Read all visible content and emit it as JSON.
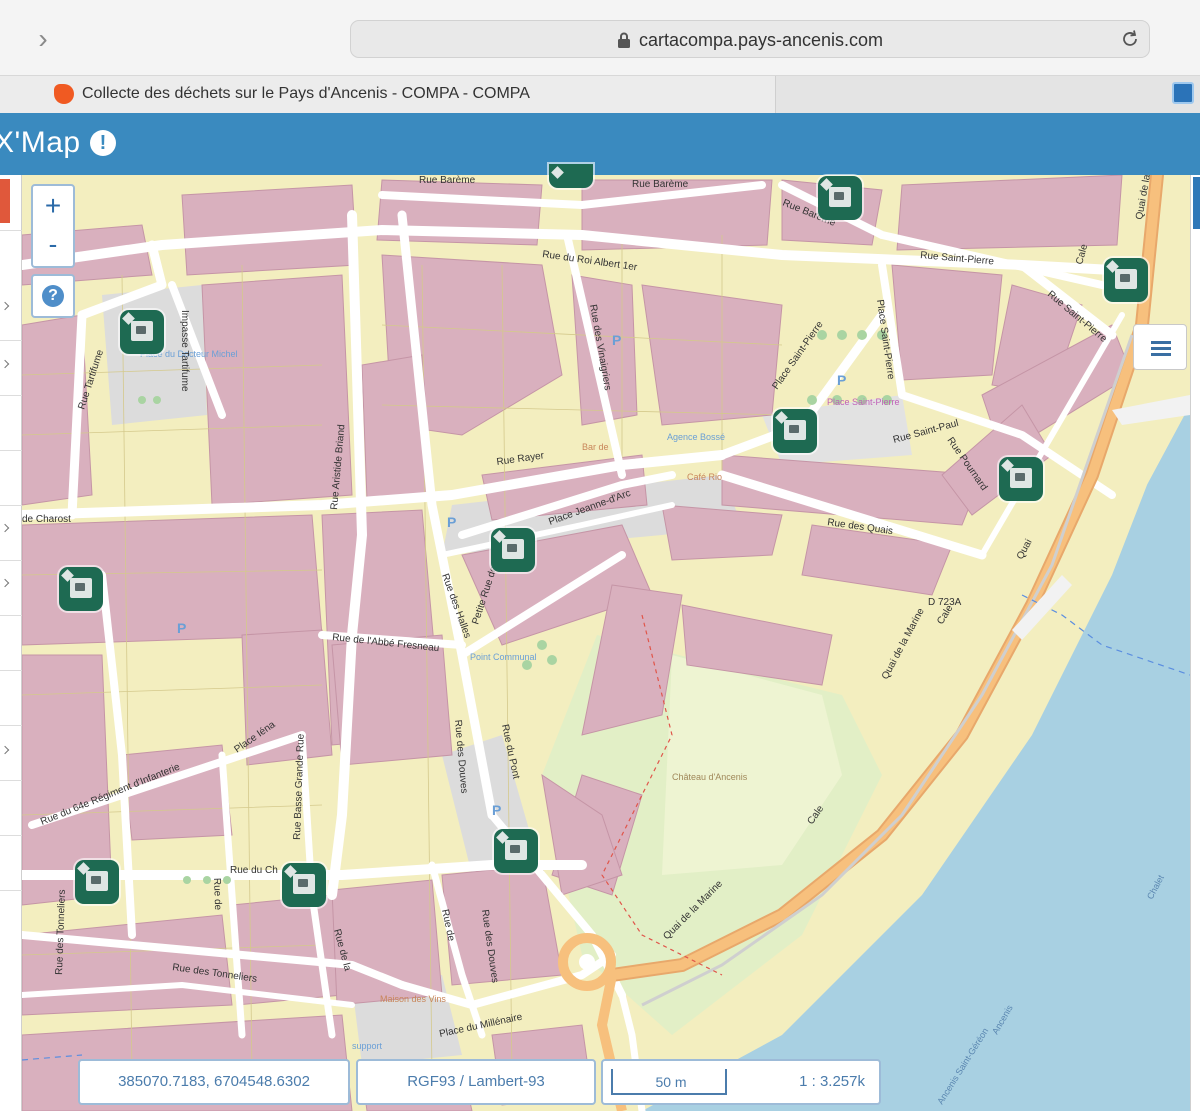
{
  "browser": {
    "url": "cartacompa.pays-ancenis.com",
    "tab_title": "Collecte des déchets sur le Pays d'Ancenis - COMPA - COMPA"
  },
  "app": {
    "title": "X'Map"
  },
  "map": {
    "zoom_in_label": "+",
    "zoom_out_label": "-",
    "help_label": "?",
    "street_labels": [
      "Rue Barème",
      "Rue Barème",
      "Rue Barème",
      "Rue du Roi Albert 1er",
      "Rue Saint-Pierre",
      "Rue Saint-Pierre",
      "Place du Docteur Michel",
      "Impasse Tartifume",
      "Rue Tartifume",
      "Rue des Vinaigriers",
      "Place Saint-Pierre",
      "Place Saint-Pierre",
      "Place Saint-Pierre",
      "Rue Saint-Paul",
      "Rue Pournard",
      "Rue Rayer",
      "Bar de",
      "Agence Bossé",
      "Café Rio",
      "Rue des Quais",
      "Place Jeanne-d'Arc",
      "de Charost",
      "Rue Aristide Briand",
      "Petite Rue des",
      "Rue des Halles",
      "Rue de l'Abbé Fresneau",
      "Point Communal",
      "Rue des Douves",
      "Rue du Pont",
      "D 723A",
      "Quai de la Marine",
      "Cale",
      "Quai",
      "Cale",
      "Quai de la Marine",
      "Château d'Ancenis",
      "Rue Basse Grande Rue",
      "Place Iéna",
      "Rue du 64e Régiment d'Infanterie",
      "Rue du Ch",
      "Rue de",
      "Rue des Tonneliers",
      "Rue des Tonneliers",
      "Maison des Vins",
      "Place du Millénaire",
      "Rue des Douves",
      "Rue de",
      "support",
      "Rue de la",
      "Quai de la Marine",
      "Cale",
      "Chalet",
      "Ancenis Saint-Géréon",
      "Ancenis"
    ],
    "layers_button": "layers-menu"
  },
  "status_bar": {
    "coordinates": "385070.7183, 6704548.6302",
    "projection": "RGF93 / Lambert-93",
    "scale_bar_label": "50 m",
    "scale_ratio": "1 : 3.257k"
  },
  "colors": {
    "header": "#3a8abf",
    "building_pink": "#d9b0be",
    "parcel_yellow": "#f3eebf",
    "water": "#a8d0e2",
    "road_orange": "#f7c07d",
    "marker_green": "#1e6a52"
  }
}
